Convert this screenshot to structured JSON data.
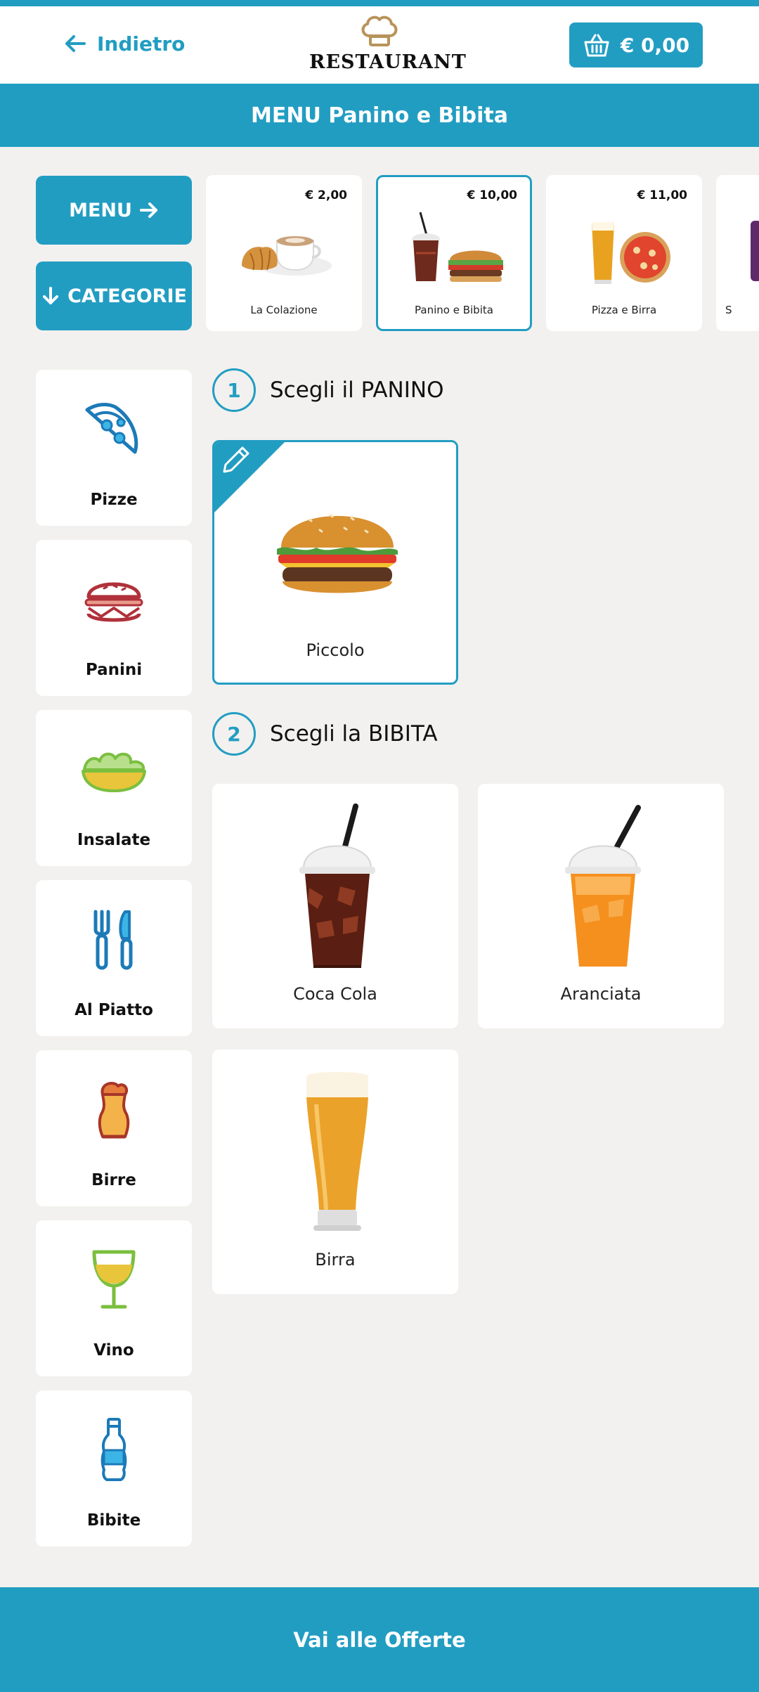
{
  "header": {
    "back_label": "Indietro",
    "logo_text": "RESTAURANT",
    "cart_total": "€ 0,00"
  },
  "title": "MENU Panino e Bibita",
  "side_buttons": {
    "menu": "MENU",
    "categories": "CATEGORIE"
  },
  "menus": [
    {
      "price": "€ 2,00",
      "label": "La Colazione"
    },
    {
      "price": "€ 10,00",
      "label": "Panino e Bibita",
      "active": true
    },
    {
      "price": "€ 11,00",
      "label": "Pizza e Birra"
    },
    {
      "price": "",
      "label": "S"
    }
  ],
  "categories": [
    {
      "label": "Pizze",
      "icon": "pizza-icon"
    },
    {
      "label": "Panini",
      "icon": "burger-icon"
    },
    {
      "label": "Insalate",
      "icon": "salad-icon"
    },
    {
      "label": "Al Piatto",
      "icon": "cutlery-icon"
    },
    {
      "label": "Birre",
      "icon": "beer-icon"
    },
    {
      "label": "Vino",
      "icon": "wine-icon"
    },
    {
      "label": "Bibite",
      "icon": "bottle-icon"
    }
  ],
  "steps": [
    {
      "number": "1",
      "label": "Scegli il PANINO"
    },
    {
      "number": "2",
      "label": "Scegli la BIBITA"
    }
  ],
  "panini": [
    {
      "label": "Piccolo",
      "selected": true
    }
  ],
  "bibite": [
    {
      "label": "Coca Cola"
    },
    {
      "label": "Aranciata"
    },
    {
      "label": "Birra"
    }
  ],
  "footer": {
    "label": "Vai alle Offerte"
  },
  "colors": {
    "accent": "#229dc2",
    "background": "#f2f1ef",
    "logo": "#b8935a"
  }
}
